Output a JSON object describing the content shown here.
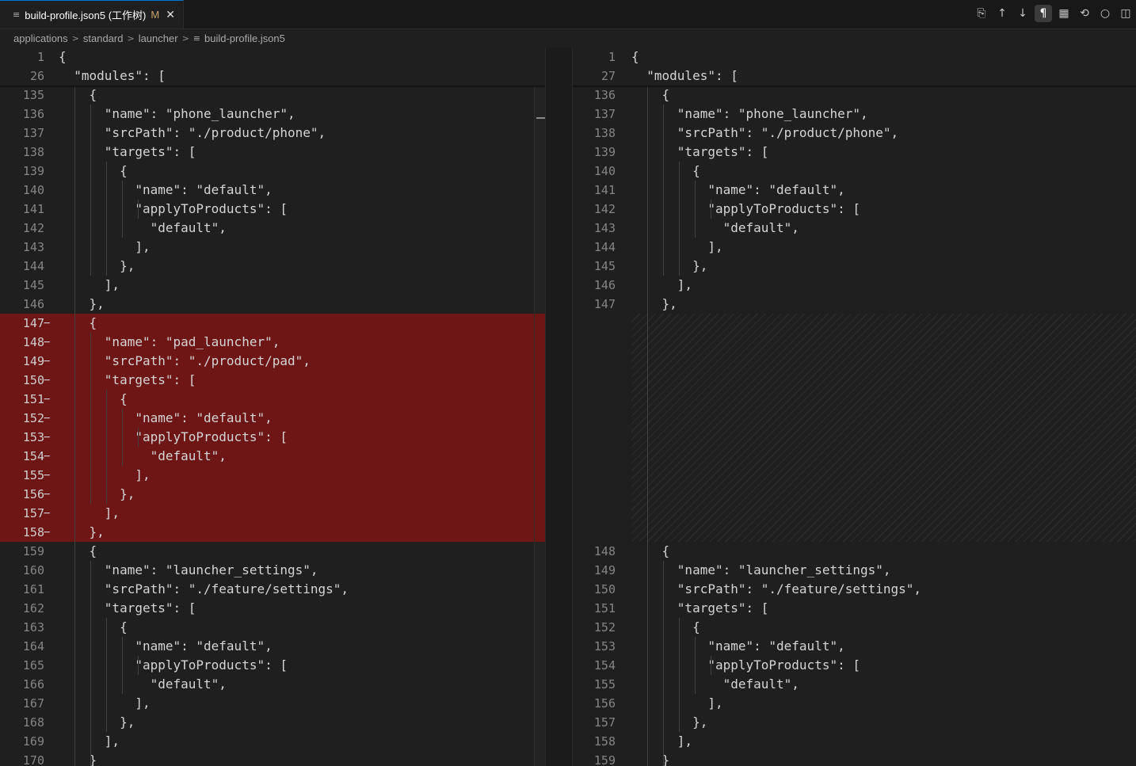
{
  "tab": {
    "file_icon": "≡",
    "title": "build-profile.json5 (工作树)",
    "modified": "M",
    "close": "✕"
  },
  "toolbar": [
    {
      "name": "open-file-icon",
      "glyph": "⎘"
    },
    {
      "name": "previous-change-icon",
      "glyph": "↑"
    },
    {
      "name": "next-change-icon",
      "glyph": "↓"
    },
    {
      "name": "whitespace-toggle-icon",
      "glyph": "¶",
      "active": true
    },
    {
      "name": "minimap-icon",
      "glyph": "▦"
    },
    {
      "name": "open-changes-icon",
      "glyph": "⟲"
    },
    {
      "name": "revert-icon",
      "glyph": "○"
    },
    {
      "name": "split-editor-icon",
      "glyph": "◫"
    }
  ],
  "breadcrumb": [
    "applications",
    "standard",
    "launcher",
    "build-profile.json5"
  ],
  "left_pane": {
    "sticky": [
      {
        "n": "1",
        "code": "{"
      },
      {
        "n": "26",
        "code": "  \"modules\": ["
      }
    ],
    "lines": [
      {
        "n": "135",
        "code": "    {"
      },
      {
        "n": "136",
        "code": "      \"name\": \"phone_launcher\","
      },
      {
        "n": "137",
        "code": "      \"srcPath\": \"./product/phone\","
      },
      {
        "n": "138",
        "code": "      \"targets\": ["
      },
      {
        "n": "139",
        "code": "        {"
      },
      {
        "n": "140",
        "code": "          \"name\": \"default\","
      },
      {
        "n": "141",
        "code": "          \"applyToProducts\": ["
      },
      {
        "n": "142",
        "code": "            \"default\","
      },
      {
        "n": "143",
        "code": "          ],"
      },
      {
        "n": "144",
        "code": "        },"
      },
      {
        "n": "145",
        "code": "      ],"
      },
      {
        "n": "146",
        "code": "    },"
      },
      {
        "n": "147",
        "code": "    {",
        "removed": true
      },
      {
        "n": "148",
        "code": "      \"name\": \"pad_launcher\",",
        "removed": true
      },
      {
        "n": "149",
        "code": "      \"srcPath\": \"./product/pad\",",
        "removed": true
      },
      {
        "n": "150",
        "code": "      \"targets\": [",
        "removed": true
      },
      {
        "n": "151",
        "code": "        {",
        "removed": true
      },
      {
        "n": "152",
        "code": "          \"name\": \"default\",",
        "removed": true
      },
      {
        "n": "153",
        "code": "          \"applyToProducts\": [",
        "removed": true
      },
      {
        "n": "154",
        "code": "            \"default\",",
        "removed": true
      },
      {
        "n": "155",
        "code": "          ],",
        "removed": true
      },
      {
        "n": "156",
        "code": "        },",
        "removed": true
      },
      {
        "n": "157",
        "code": "      ],",
        "removed": true
      },
      {
        "n": "158",
        "code": "    },",
        "removed": true
      },
      {
        "n": "159",
        "code": "    {"
      },
      {
        "n": "160",
        "code": "      \"name\": \"launcher_settings\","
      },
      {
        "n": "161",
        "code": "      \"srcPath\": \"./feature/settings\","
      },
      {
        "n": "162",
        "code": "      \"targets\": ["
      },
      {
        "n": "163",
        "code": "        {"
      },
      {
        "n": "164",
        "code": "          \"name\": \"default\","
      },
      {
        "n": "165",
        "code": "          \"applyToProducts\": ["
      },
      {
        "n": "166",
        "code": "            \"default\","
      },
      {
        "n": "167",
        "code": "          ],"
      },
      {
        "n": "168",
        "code": "        },"
      },
      {
        "n": "169",
        "code": "      ],"
      },
      {
        "n": "170",
        "code": "    }"
      }
    ]
  },
  "right_pane": {
    "sticky": [
      {
        "n": "1",
        "code": "{"
      },
      {
        "n": "27",
        "code": "  \"modules\": ["
      }
    ],
    "lines": [
      {
        "n": "136",
        "code": "    {"
      },
      {
        "n": "137",
        "code": "      \"name\": \"phone_launcher\","
      },
      {
        "n": "138",
        "code": "      \"srcPath\": \"./product/phone\","
      },
      {
        "n": "139",
        "code": "      \"targets\": ["
      },
      {
        "n": "140",
        "code": "        {"
      },
      {
        "n": "141",
        "code": "          \"name\": \"default\","
      },
      {
        "n": "142",
        "code": "          \"applyToProducts\": ["
      },
      {
        "n": "143",
        "code": "            \"default\","
      },
      {
        "n": "144",
        "code": "          ],"
      },
      {
        "n": "145",
        "code": "        },"
      },
      {
        "n": "146",
        "code": "      ],"
      },
      {
        "n": "147",
        "code": "    },"
      },
      {
        "n": "",
        "code": "",
        "spacer": true
      },
      {
        "n": "",
        "code": "",
        "spacer": true
      },
      {
        "n": "",
        "code": "",
        "spacer": true
      },
      {
        "n": "",
        "code": "",
        "spacer": true
      },
      {
        "n": "",
        "code": "",
        "spacer": true
      },
      {
        "n": "",
        "code": "",
        "spacer": true
      },
      {
        "n": "",
        "code": "",
        "spacer": true
      },
      {
        "n": "",
        "code": "",
        "spacer": true
      },
      {
        "n": "",
        "code": "",
        "spacer": true
      },
      {
        "n": "",
        "code": "",
        "spacer": true
      },
      {
        "n": "",
        "code": "",
        "spacer": true
      },
      {
        "n": "",
        "code": "",
        "spacer": true
      },
      {
        "n": "148",
        "code": "    {"
      },
      {
        "n": "149",
        "code": "      \"name\": \"launcher_settings\","
      },
      {
        "n": "150",
        "code": "      \"srcPath\": \"./feature/settings\","
      },
      {
        "n": "151",
        "code": "      \"targets\": ["
      },
      {
        "n": "152",
        "code": "        {"
      },
      {
        "n": "153",
        "code": "          \"name\": \"default\","
      },
      {
        "n": "154",
        "code": "          \"applyToProducts\": ["
      },
      {
        "n": "155",
        "code": "            \"default\","
      },
      {
        "n": "156",
        "code": "          ],"
      },
      {
        "n": "157",
        "code": "        },"
      },
      {
        "n": "158",
        "code": "      ],"
      },
      {
        "n": "159",
        "code": "    }"
      }
    ]
  },
  "diff_marker": "−",
  "colors": {
    "removed_bg": "#6e1616",
    "accent": "#0078d4"
  }
}
